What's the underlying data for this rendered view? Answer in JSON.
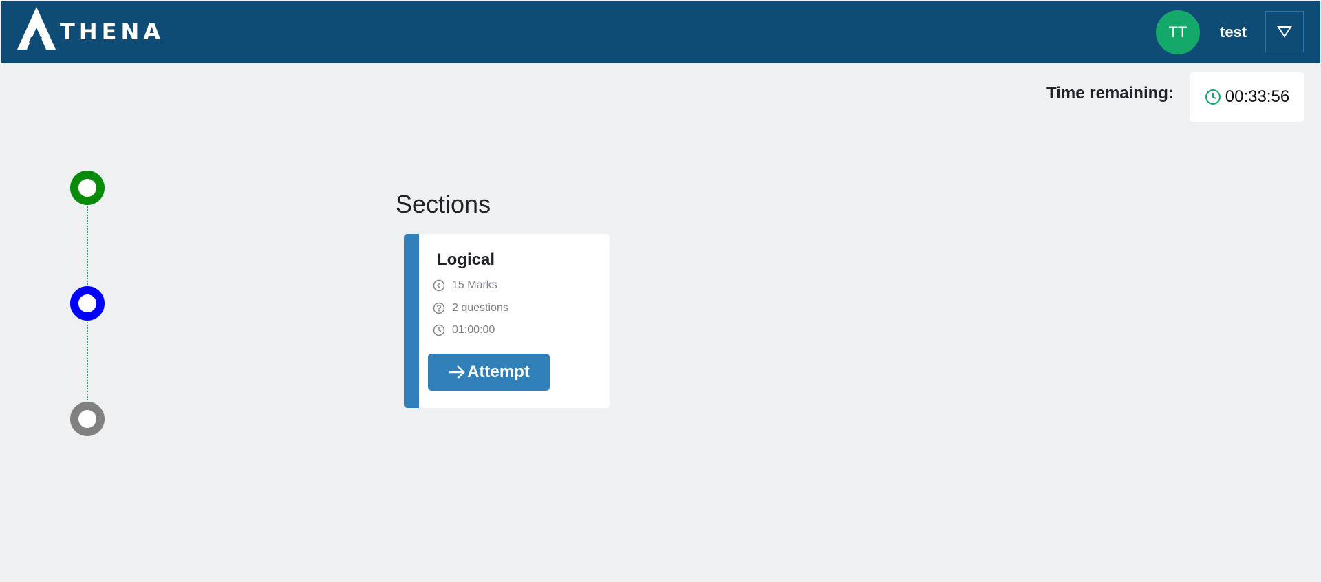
{
  "header": {
    "logo_text": "THENA",
    "avatar_initials": "TT",
    "username": "test",
    "brand_color": "#0f4c75",
    "avatar_color": "#14a86b"
  },
  "timer": {
    "label": "Time remaining:",
    "value": "00:33:56"
  },
  "stepper": {
    "steps": [
      {
        "status": "completed",
        "color": "#0a8a0a"
      },
      {
        "status": "current",
        "color": "#0000ff"
      },
      {
        "status": "pending",
        "color": "#808080"
      }
    ]
  },
  "sections": {
    "title": "Sections",
    "items": [
      {
        "name": "Logical",
        "marks": "15 Marks",
        "questions": "2 questions",
        "duration": "01:00:00",
        "button_label": "Attempt",
        "accent_color": "#3180ba"
      }
    ]
  }
}
